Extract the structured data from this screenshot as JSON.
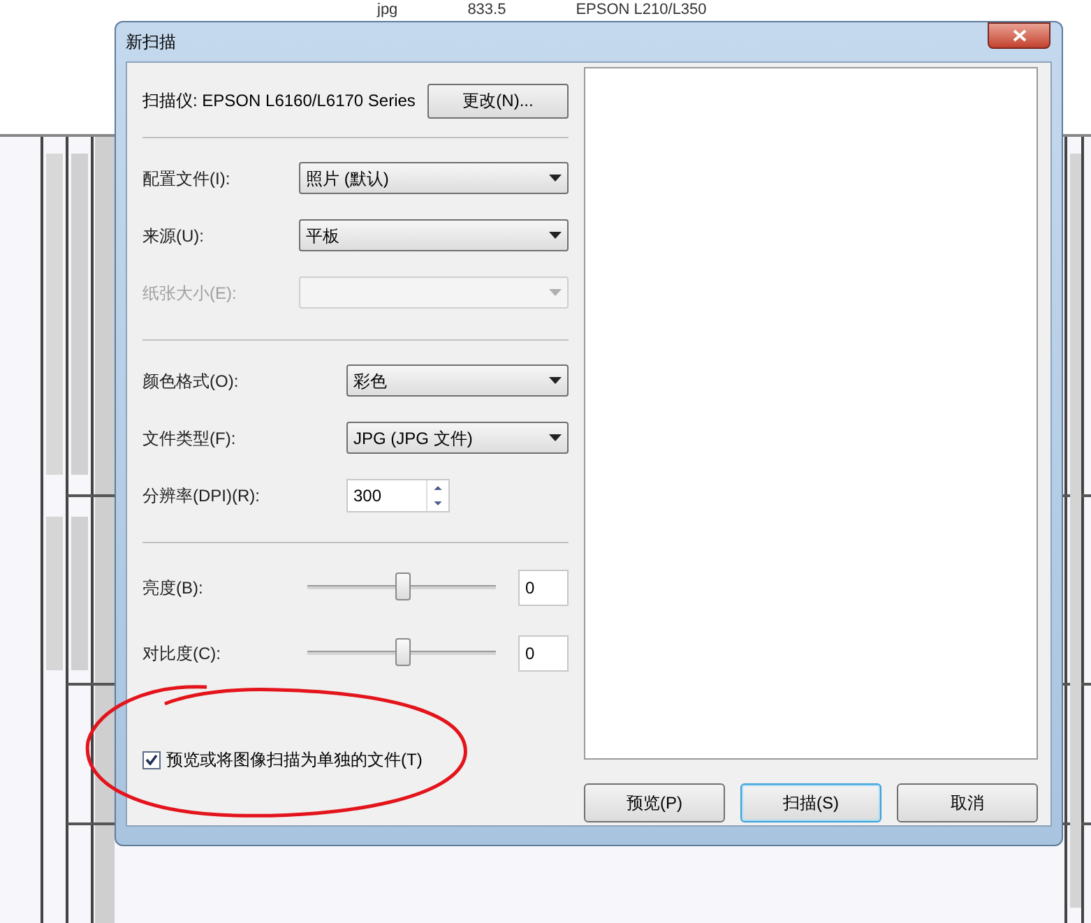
{
  "background_list": {
    "cells": [
      "jpg",
      "833.5",
      "EPSON L210/L350"
    ]
  },
  "dialog": {
    "title": "新扫描",
    "scanner": {
      "label": "扫描仪: EPSON L6160/L6170 Series",
      "button": "更改(N)..."
    },
    "sections": [
      [
        {
          "kind": "dropdown",
          "label": "配置文件(I):",
          "value": "照片 (默认)",
          "disabled": false
        },
        {
          "kind": "dropdown",
          "label": "来源(U):",
          "value": "平板",
          "disabled": false
        },
        {
          "kind": "dropdown",
          "label": "纸张大小(E):",
          "disabled": true
        }
      ],
      [
        {
          "kind": "dropdown",
          "label": "颜色格式(O):",
          "value": "彩色",
          "disabled": false
        },
        {
          "kind": "dropdown",
          "label": "文件类型(F):",
          "value": "JPG (JPG 文件)",
          "disabled": false
        },
        {
          "kind": "spinner",
          "label": "分辨率(DPI)(R):",
          "value": "300"
        }
      ],
      [
        {
          "kind": "slider",
          "label": "亮度(B):",
          "level": 0.5,
          "value": "0"
        },
        {
          "kind": "slider",
          "label": "对比度(C):",
          "level": 0.5,
          "value": "0"
        }
      ]
    ],
    "checkbox": {
      "label": "预览或将图像扫描为单独的文件(T)",
      "checked": true
    },
    "buttons": [
      {
        "label": "预览(P)",
        "default": false
      },
      {
        "label": "扫描(S)",
        "default": true
      },
      {
        "label": "取消",
        "default": false
      }
    ]
  }
}
